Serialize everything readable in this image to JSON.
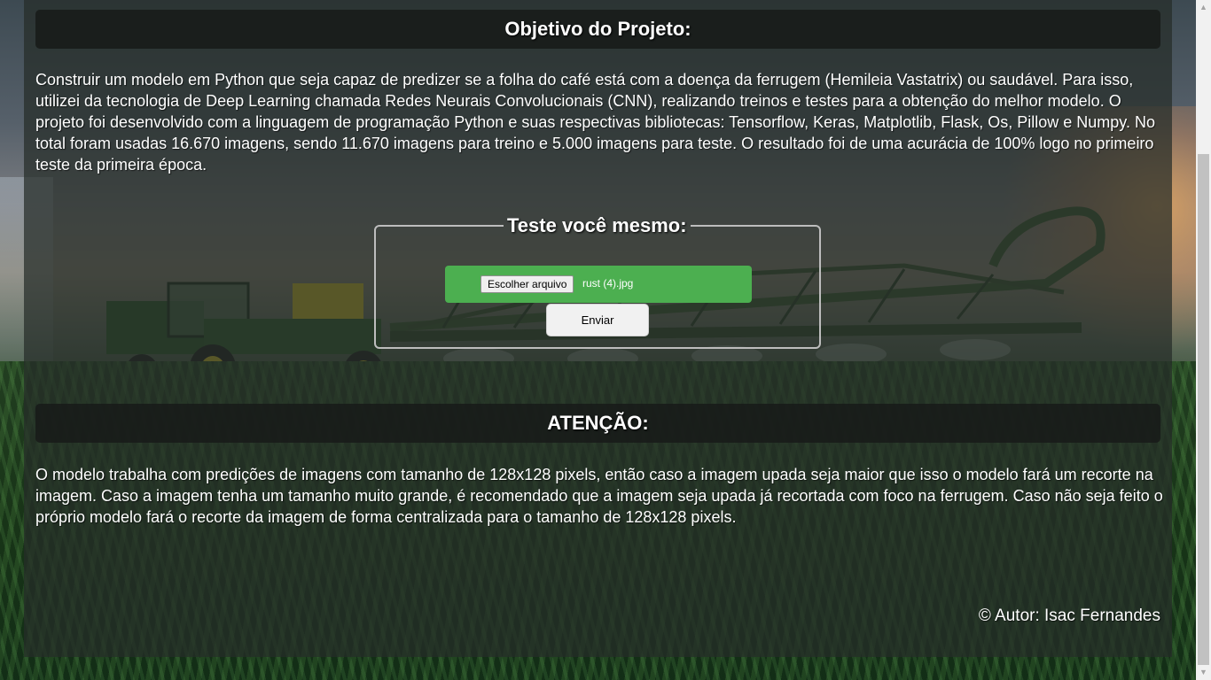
{
  "objective": {
    "title": "Objetivo do Projeto:",
    "text": "Construir um modelo em Python que seja capaz de predizer se a folha do café está com a doença da ferrugem (Hemileia Vastatrix) ou saudável. Para isso, utilizei da tecnologia de Deep Learning chamada Redes Neurais Convolucionais (CNN), realizando treinos e testes para a obtenção do melhor modelo. O projeto foi desenvolvido com a linguagem de programação Python e suas respectivas bibliotecas: Tensorflow, Keras, Matplotlib, Flask, Os, Pillow e Numpy. No total foram usadas 16.670 imagens, sendo 11.670 imagens para treino e 5.000 imagens para teste. O resultado foi de uma acurácia de 100% logo no primeiro teste da primeira época."
  },
  "test_form": {
    "legend": "Teste você mesmo:",
    "file_button_label": "Escolher arquivo",
    "file_name": "rust (4).jpg",
    "submit_label": "Enviar"
  },
  "attention": {
    "title": "ATENÇÃO:",
    "text": "O modelo trabalha com predições de imagens com tamanho de 128x128 pixels, então caso a imagem upada seja maior que isso o modelo fará um recorte na imagem. Caso a imagem tenha um tamanho muito grande, é recomendado que a imagem seja upada já recortada com foco na ferrugem. Caso não seja feito o próprio modelo fará o recorte da imagem de forma centralizada para o tamanho de 128x128 pixels."
  },
  "footer": {
    "author": "© Autor: Isac Fernandes"
  },
  "colors": {
    "file_row": "#4caf50",
    "header_bg": "#181c1a",
    "text": "#ffffff"
  }
}
